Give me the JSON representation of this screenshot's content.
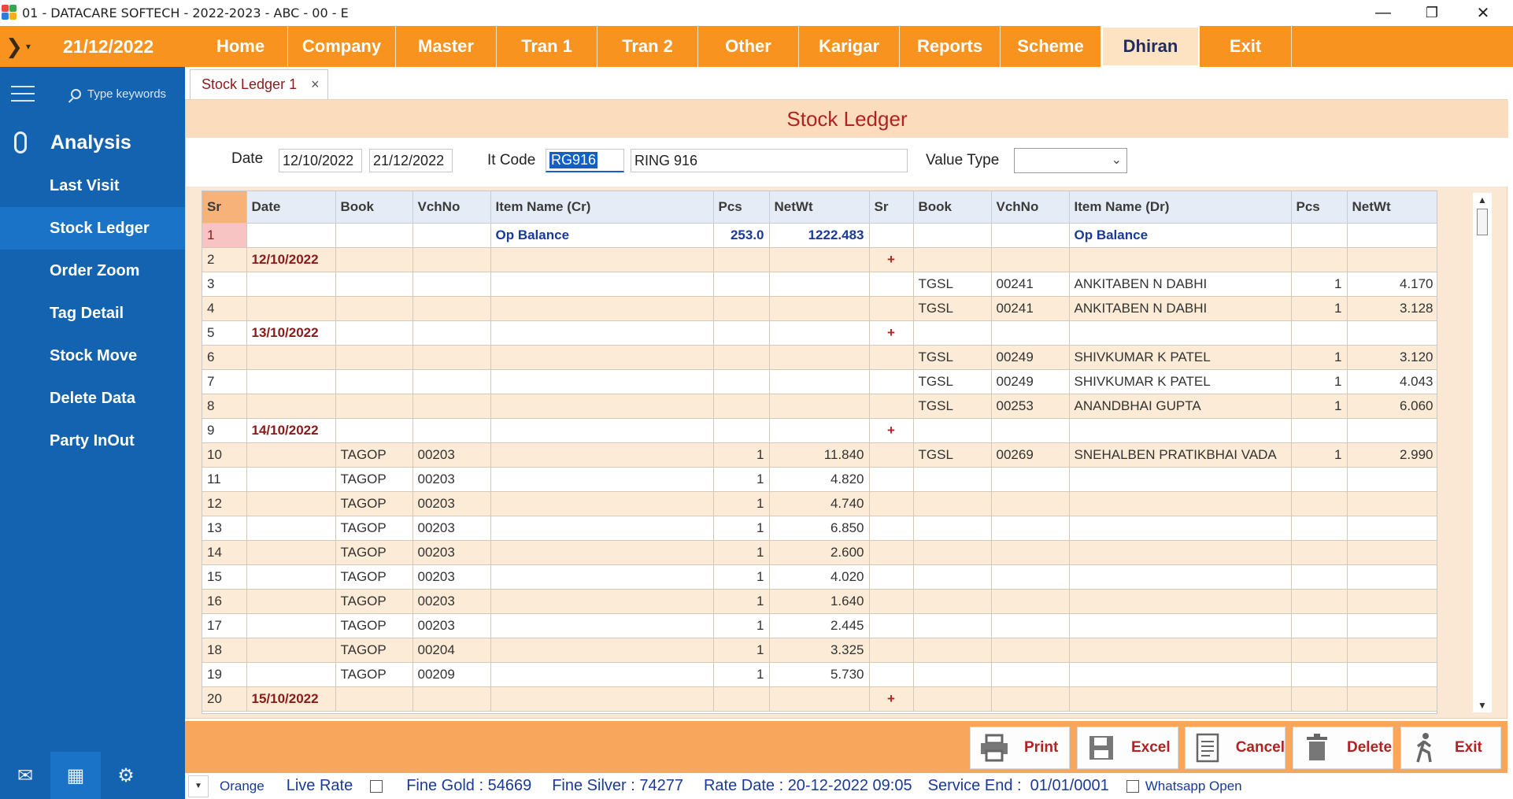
{
  "window": {
    "title": "01 - DATACARE SOFTECH - 2022-2023 - ABC - 00 - E",
    "minimize": "—",
    "restore": "❐",
    "close": "✕"
  },
  "menubar": {
    "date": "21/12/2022",
    "items": [
      "Home",
      "Company",
      "Master",
      "Tran 1",
      "Tran 2",
      "Other",
      "Karigar",
      "Reports",
      "Scheme",
      "Dhiran",
      "Exit"
    ],
    "active": "Dhiran"
  },
  "sidebar": {
    "search_placeholder": "Type keywords",
    "section": "Analysis",
    "items": [
      "Last Visit",
      "Stock Ledger",
      "Order Zoom",
      "Tag Detail",
      "Stock Move",
      "Delete Data",
      "Party InOut"
    ],
    "active": "Stock Ledger",
    "bottom_icons": [
      "mail-icon",
      "calendar-icon",
      "user-settings-icon"
    ]
  },
  "tab": {
    "label": "Stock Ledger 1",
    "close": "×"
  },
  "page": {
    "heading": "Stock Ledger"
  },
  "filters": {
    "date_label": "Date",
    "date_from": "12/10/2022",
    "date_to": "21/12/2022",
    "itcode_label": "It Code",
    "itcode_value": "RG916",
    "item_name": "RING 916",
    "value_type_label": "Value Type",
    "value_type_value": ""
  },
  "grid": {
    "columns": [
      "Sr",
      "Date",
      "Book",
      "VchNo",
      "Item Name (Cr)",
      "Pcs",
      "NetWt",
      "Sr",
      "Book",
      "VchNo",
      "Item Name (Dr)",
      "Pcs",
      "NetWt"
    ],
    "rows": [
      [
        "1",
        "",
        "",
        "",
        "Op Balance",
        "253.0",
        "1222.483",
        "",
        "",
        "",
        "Op Balance",
        "",
        ""
      ],
      [
        "2",
        "12/10/2022",
        "",
        "",
        "",
        "",
        "",
        "+",
        "",
        "",
        "",
        "",
        ""
      ],
      [
        "3",
        "",
        "",
        "",
        "",
        "",
        "",
        "",
        "TGSL",
        "00241",
        "ANKITABEN N DABHI",
        "1",
        "4.170"
      ],
      [
        "4",
        "",
        "",
        "",
        "",
        "",
        "",
        "",
        "TGSL",
        "00241",
        "ANKITABEN N DABHI",
        "1",
        "3.128"
      ],
      [
        "5",
        "13/10/2022",
        "",
        "",
        "",
        "",
        "",
        "+",
        "",
        "",
        "",
        "",
        ""
      ],
      [
        "6",
        "",
        "",
        "",
        "",
        "",
        "",
        "",
        "TGSL",
        "00249",
        "SHIVKUMAR K PATEL",
        "1",
        "3.120"
      ],
      [
        "7",
        "",
        "",
        "",
        "",
        "",
        "",
        "",
        "TGSL",
        "00249",
        "SHIVKUMAR K PATEL",
        "1",
        "4.043"
      ],
      [
        "8",
        "",
        "",
        "",
        "",
        "",
        "",
        "",
        "TGSL",
        "00253",
        "ANANDBHAI GUPTA",
        "1",
        "6.060"
      ],
      [
        "9",
        "14/10/2022",
        "",
        "",
        "",
        "",
        "",
        "+",
        "",
        "",
        "",
        "",
        ""
      ],
      [
        "10",
        "",
        "TAGOP",
        "00203",
        "",
        "1",
        "11.840",
        "",
        "TGSL",
        "00269",
        "SNEHALBEN PRATIKBHAI VADA",
        "1",
        "2.990"
      ],
      [
        "11",
        "",
        "TAGOP",
        "00203",
        "",
        "1",
        "4.820",
        "",
        "",
        "",
        "",
        "",
        ""
      ],
      [
        "12",
        "",
        "TAGOP",
        "00203",
        "",
        "1",
        "4.740",
        "",
        "",
        "",
        "",
        "",
        ""
      ],
      [
        "13",
        "",
        "TAGOP",
        "00203",
        "",
        "1",
        "6.850",
        "",
        "",
        "",
        "",
        "",
        ""
      ],
      [
        "14",
        "",
        "TAGOP",
        "00203",
        "",
        "1",
        "2.600",
        "",
        "",
        "",
        "",
        "",
        ""
      ],
      [
        "15",
        "",
        "TAGOP",
        "00203",
        "",
        "1",
        "4.020",
        "",
        "",
        "",
        "",
        "",
        ""
      ],
      [
        "16",
        "",
        "TAGOP",
        "00203",
        "",
        "1",
        "1.640",
        "",
        "",
        "",
        "",
        "",
        ""
      ],
      [
        "17",
        "",
        "TAGOP",
        "00203",
        "",
        "1",
        "2.445",
        "",
        "",
        "",
        "",
        "",
        ""
      ],
      [
        "18",
        "",
        "TAGOP",
        "00204",
        "",
        "1",
        "3.325",
        "",
        "",
        "",
        "",
        "",
        ""
      ],
      [
        "19",
        "",
        "TAGOP",
        "00209",
        "",
        "1",
        "5.730",
        "",
        "",
        "",
        "",
        "",
        ""
      ],
      [
        "20",
        "15/10/2022",
        "",
        "",
        "",
        "",
        "",
        "+",
        "",
        "",
        "",
        "",
        ""
      ]
    ]
  },
  "actions": [
    "Print",
    "Excel",
    "Cancel",
    "Delete",
    "Exit"
  ],
  "status": {
    "theme": "Orange",
    "live_rate": "Live Rate",
    "fine_gold": "Fine Gold : 54669",
    "fine_silver": "Fine Silver : 74277",
    "rate_date": "Rate Date : 20-12-2022 09:05",
    "service_end": "Service End :  01/01/0001",
    "whatsapp": "Whatsapp Open"
  },
  "colors": {
    "menu_bg": "#f7931e",
    "sidebar_bg": "#1463b0",
    "heading_text": "#b22222",
    "action_bar_bg": "#f7a65c"
  }
}
